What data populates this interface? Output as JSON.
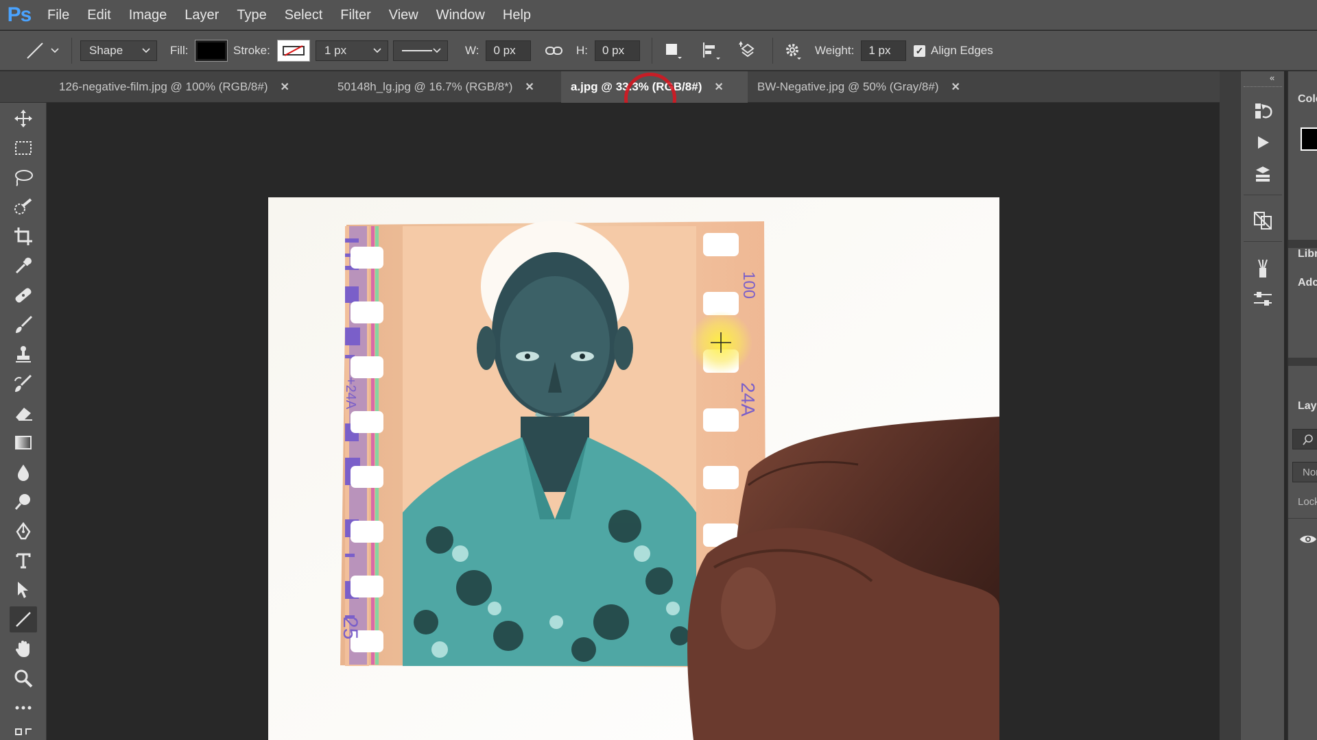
{
  "app": {
    "logo": "Ps"
  },
  "menu": [
    "File",
    "Edit",
    "Image",
    "Layer",
    "Type",
    "Select",
    "Filter",
    "View",
    "Window",
    "Help"
  ],
  "options": {
    "mode": "Shape",
    "fill_label": "Fill:",
    "fill_color": "#000000",
    "stroke_label": "Stroke:",
    "stroke_width": "1 px",
    "w_label": "W:",
    "w_value": "0 px",
    "h_label": "H:",
    "h_value": "0 px",
    "weight_label": "Weight:",
    "weight_value": "1 px",
    "align_edges_label": "Align Edges",
    "align_edges_checked": true
  },
  "tabs": [
    {
      "label": "126-negative-film.jpg @ 100% (RGB/8#)",
      "active": false
    },
    {
      "label": "50148h_lg.jpg @ 16.7% (RGB/8*)",
      "active": false
    },
    {
      "label": "a.jpg @ 33.3% (RGB/8#)",
      "active": true
    },
    {
      "label": "BW-Negative.jpg @ 50% (Gray/8#)",
      "active": false
    }
  ],
  "tools": [
    "move-tool",
    "marquee-tool",
    "lasso-tool",
    "quick-selection-tool",
    "crop-tool",
    "eyedropper-tool",
    "healing-brush-tool",
    "brush-tool",
    "clone-stamp-tool",
    "history-brush-tool",
    "eraser-tool",
    "gradient-tool",
    "blur-tool",
    "dodge-tool",
    "pen-tool",
    "type-tool",
    "path-selection-tool",
    "line-tool",
    "hand-tool",
    "zoom-tool",
    "more-tools"
  ],
  "film": {
    "frame_number_top": "100",
    "frame_code_right": "24A",
    "frame_code_left": "+24A",
    "frame_number_bottom": "25"
  },
  "right_panel": {
    "color_label": "Colo",
    "libraries_label": "Libr",
    "adjustments_label": "Adc",
    "layers_label": "Laye",
    "blend_mode": "Nor",
    "lock_label": "Lock"
  }
}
